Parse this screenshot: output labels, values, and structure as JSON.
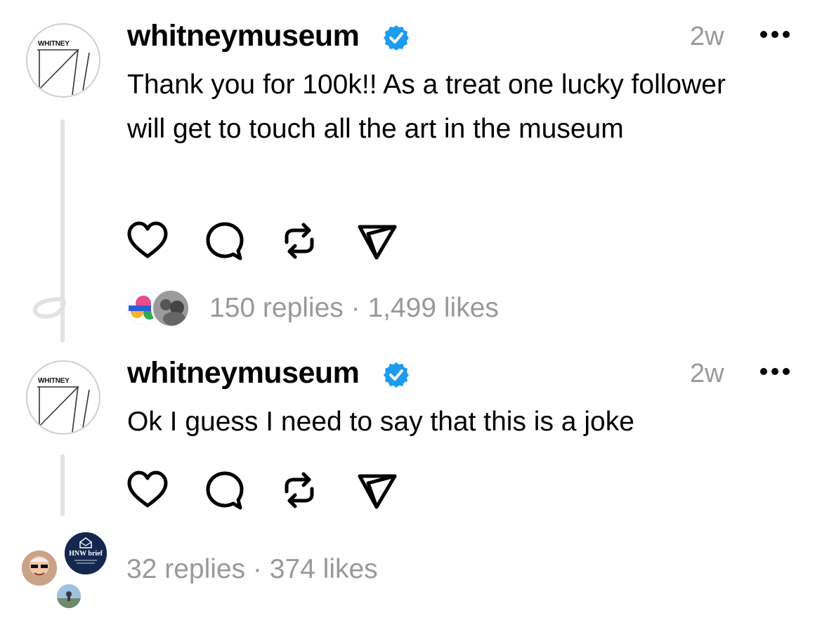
{
  "posts": [
    {
      "avatar_text": "WHITNEY",
      "username": "whitneymuseum",
      "time": "2w",
      "body": "Thank you for 100k!! As a treat one lucky follower will get to touch all the art in the museum",
      "stats": "150 replies · 1,499 likes"
    },
    {
      "avatar_text": "WHITNEY",
      "username": "whitneymuseum",
      "time": "2w",
      "body": "Ok I guess I need to say that this is a joke",
      "stats": "32 replies · 374 likes",
      "reply_avatar_text": "HNW brief"
    }
  ],
  "icons": [
    "heart-icon",
    "comment-icon",
    "repost-icon",
    "share-icon",
    "more-icon",
    "verified-icon"
  ],
  "colors": {
    "verified": "#1d9bf0",
    "muted": "#999999",
    "thread_line": "#e2e2e2"
  }
}
